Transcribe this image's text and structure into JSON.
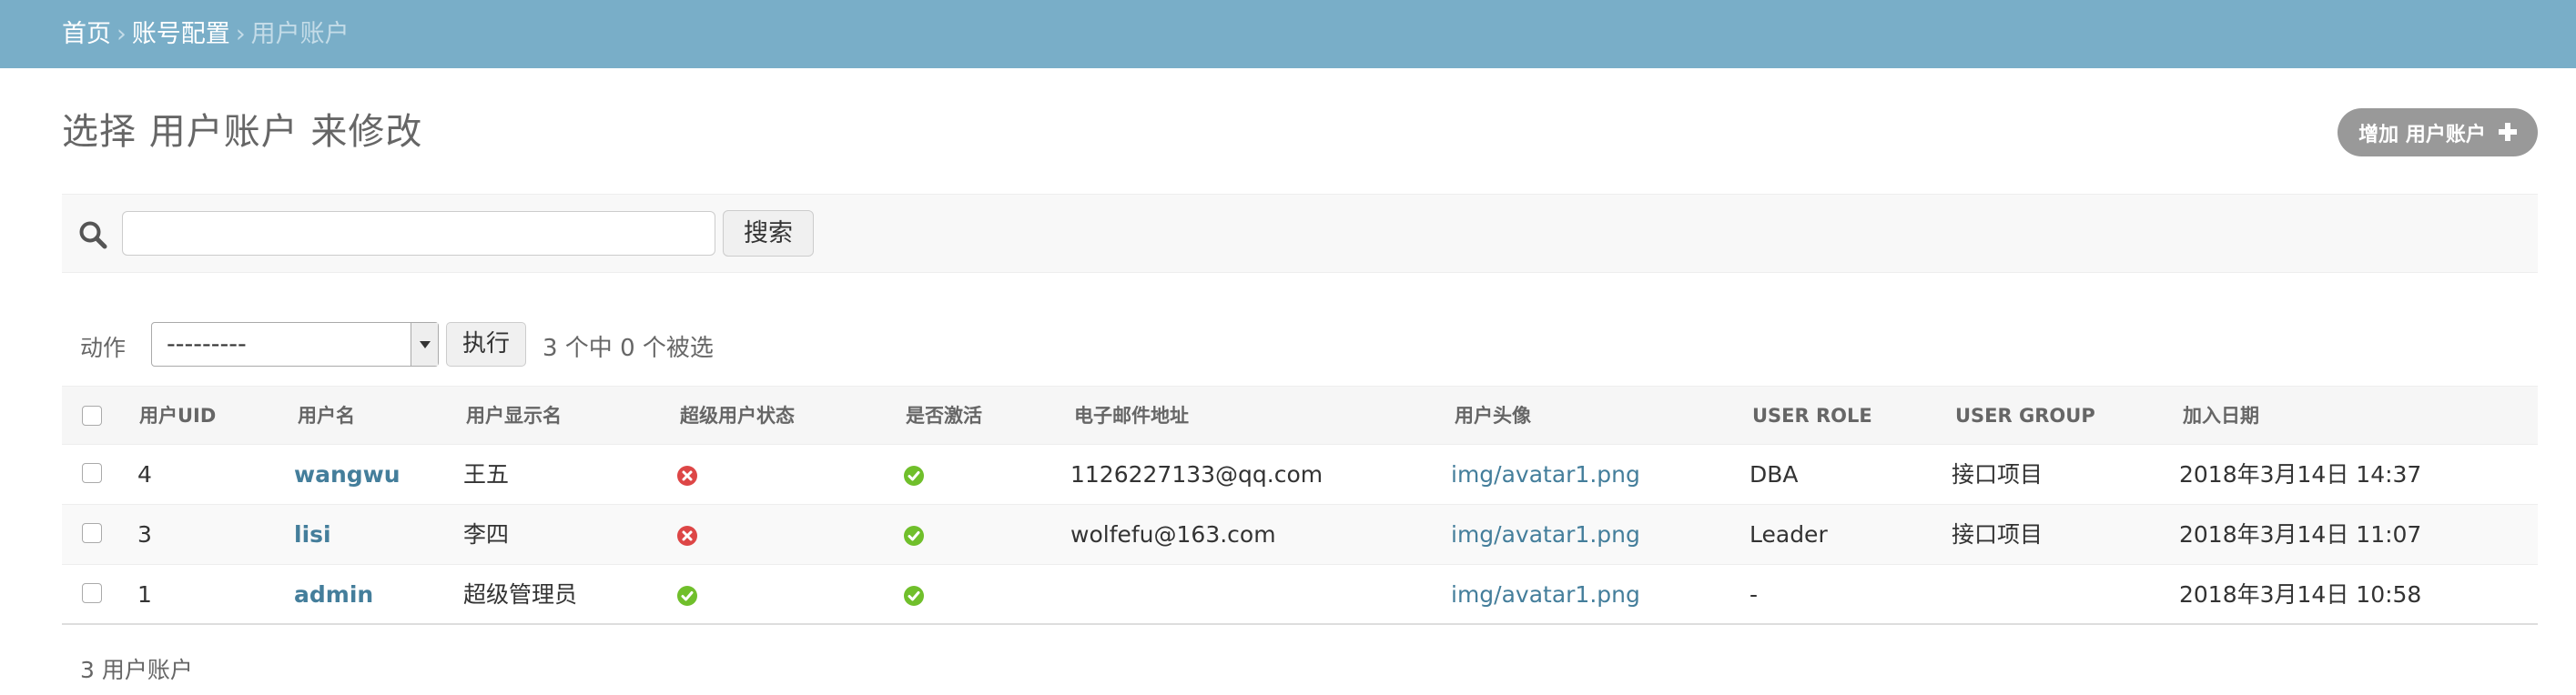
{
  "breadcrumb": {
    "home": "首页",
    "section": "账号配置",
    "current": "用户账户",
    "separator": "›"
  },
  "page": {
    "title": "选择 用户账户 来修改",
    "add_button_label": "增加 用户账户"
  },
  "search": {
    "value": "",
    "placeholder": "",
    "button_label": "搜索"
  },
  "actions": {
    "label": "动作",
    "selected_option": "---------",
    "go_button_label": "执行",
    "selection_counter": "3 个中 0 个被选"
  },
  "table": {
    "columns": [
      "用户UID",
      "用户名",
      "用户显示名",
      "超级用户状态",
      "是否激活",
      "电子邮件地址",
      "用户头像",
      "USER ROLE",
      "USER GROUP",
      "加入日期"
    ],
    "rows": [
      {
        "uid": "4",
        "username": "wangwu",
        "display_name": "王五",
        "is_superuser": false,
        "is_active": true,
        "email": "1126227133@qq.com",
        "avatar": "img/avatar1.png",
        "role": "DBA",
        "group": "接口项目",
        "joined": "2018年3月14日 14:37"
      },
      {
        "uid": "3",
        "username": "lisi",
        "display_name": "李四",
        "is_superuser": false,
        "is_active": true,
        "email": "wolfefu@163.com",
        "avatar": "img/avatar1.png",
        "role": "Leader",
        "group": "接口项目",
        "joined": "2018年3月14日 11:07"
      },
      {
        "uid": "1",
        "username": "admin",
        "display_name": "超级管理员",
        "is_superuser": true,
        "is_active": true,
        "email": "",
        "avatar": "img/avatar1.png",
        "role": "-",
        "group": "",
        "joined": "2018年3月14日 10:58"
      }
    ]
  },
  "footer": {
    "result_count": "3 用户账户"
  },
  "icons": {
    "search": "search-icon",
    "add": "plus-icon",
    "yes": "check-circle-icon",
    "no": "x-circle-icon",
    "dropdown": "chevron-down-icon"
  },
  "colors": {
    "header_bar": "#79aec8",
    "link": "#447e9b",
    "add_button": "#999999",
    "yes_icon": "#70bf2b",
    "no_icon": "#dd4646"
  }
}
